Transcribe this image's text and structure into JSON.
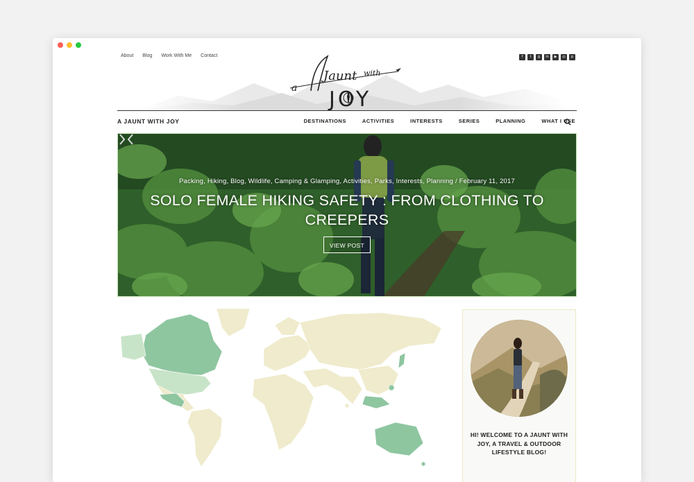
{
  "topnav": {
    "items": [
      "About",
      "Blog",
      "Work With Me",
      "Contact"
    ]
  },
  "header": {
    "logo_text_top": "a Jaunt with",
    "logo_text_bottom": "JOY"
  },
  "social": {
    "icons": [
      "facebook-icon",
      "twitter-icon",
      "google-plus-icon",
      "linkedin-icon",
      "youtube-icon",
      "instagram-icon",
      "pinterest-icon"
    ]
  },
  "brand": "A JAUNT WITH JOY",
  "mainnav": {
    "items": [
      "DESTINATIONS",
      "ACTIVITIES",
      "INTERESTS",
      "SERIES",
      "PLANNING",
      "WHAT I USE"
    ]
  },
  "hero": {
    "categories": "Packing, Hiking, Blog, Wildlife, Camping & Glamping, Activities, Parks, Interests, Planning / February 11, 2017",
    "title": "SOLO FEMALE HIKING SAFETY : FROM CLOTHING TO CREEPERS",
    "button": "VIEW POST"
  },
  "sidebar": {
    "welcome": "HI! WELCOME TO A JAUNT WITH JOY, A TRAVEL & OUTDOOR LIFESTYLE BLOG!"
  },
  "colors": {
    "map_base": "#efebcc",
    "map_visited": "#8ec6a0",
    "map_light": "#c8e4c8",
    "hero_green": "#3f7a34"
  }
}
